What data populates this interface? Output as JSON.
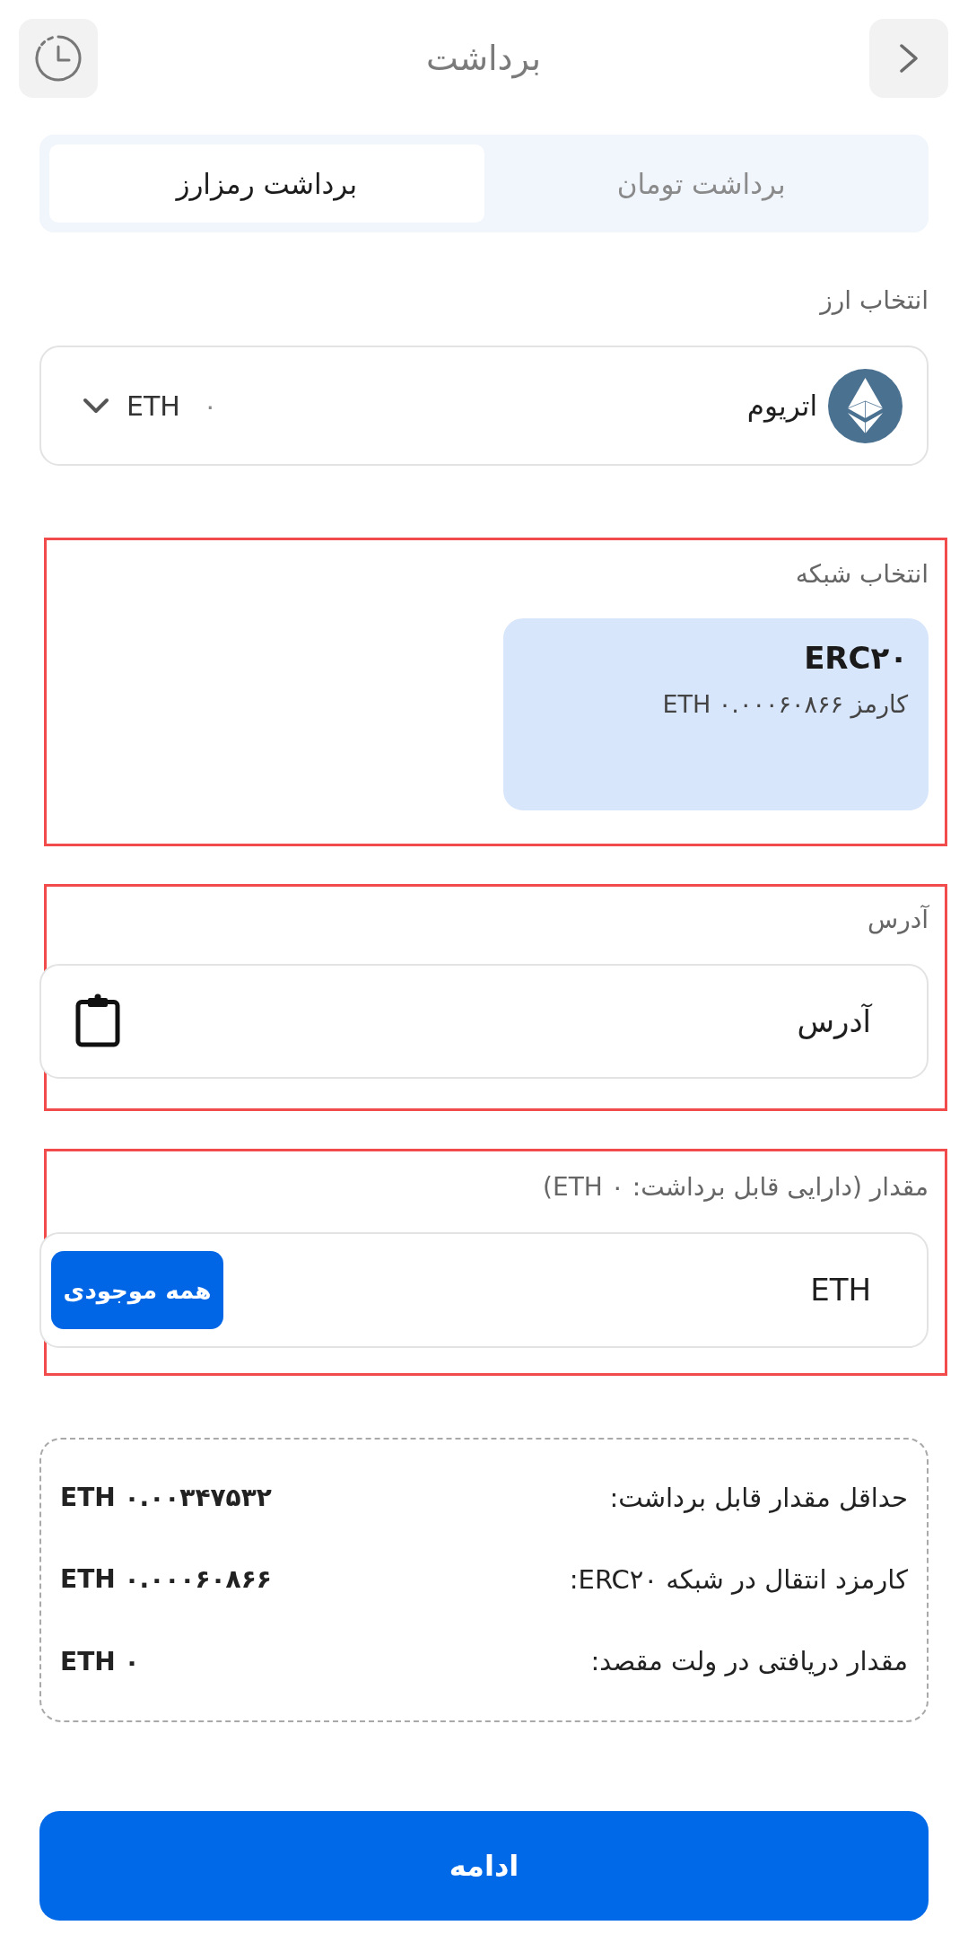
{
  "header": {
    "title": "برداشت"
  },
  "tabs": [
    {
      "label": "برداشت تومان",
      "selected": false
    },
    {
      "label": "برداشت رمزارز",
      "selected": true
    }
  ],
  "currency": {
    "label": "انتخاب ارز",
    "name": "اتریوم",
    "balance": "۰",
    "symbol": "ETH"
  },
  "network": {
    "label": "انتخاب شبکه",
    "highlighted": true,
    "options": [
      {
        "name": "ERC۲۰",
        "fee": "کارمز ۰.۰۰۰۶۰۸۶۶ ETH",
        "selected": true
      }
    ]
  },
  "address": {
    "label": "آدرس",
    "placeholder": "آدرس",
    "highlighted": true
  },
  "amount": {
    "label": "مقدار (دارایی قابل برداشت: ۰ ETH)",
    "placeholder": "ETH",
    "all_button": "همه موجودی",
    "highlighted": true
  },
  "summary": {
    "rows": [
      {
        "label": "حداقل مقدار قابل برداشت:",
        "value": "ETH ۰.۰۰۳۴۷۵۳۲"
      },
      {
        "label": "کارمزد انتقال در شبکه ERC۲۰:",
        "value": "ETH ۰.۰۰۰۶۰۸۶۶"
      },
      {
        "label": "مقدار دریافتی در ولت مقصد:",
        "value": "ETH ۰"
      }
    ]
  },
  "continue_button": "ادامه"
}
